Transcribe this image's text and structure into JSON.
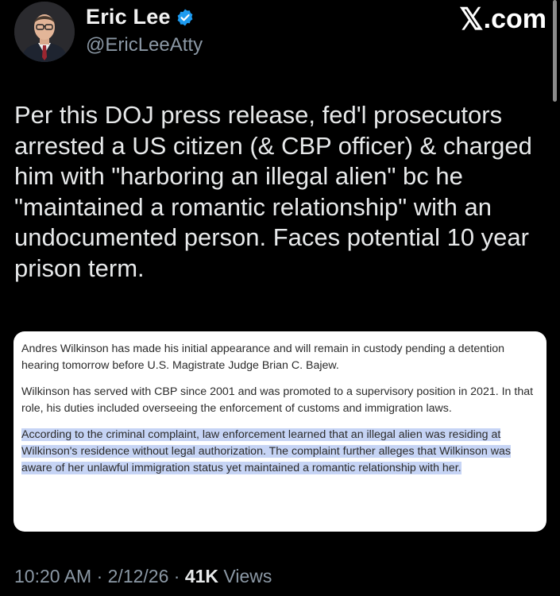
{
  "author": {
    "name": "Eric Lee",
    "handle": "@EricLeeAtty"
  },
  "brand": {
    "x_mark": "𝕏",
    "suffix": ".com"
  },
  "tweet": {
    "text": "Per this DOJ press release, fed'l prosecutors\narrested a US citizen (& CBP officer) & charged\nhim with \"harboring an illegal alien\" bc he\n\"maintained a romantic relationship\" with an\nundocumented person. Faces potential 10 year\nprison term."
  },
  "press_release": {
    "para1": "Andres Wilkinson has made his initial appearance and will remain in custody pending a detention hearing tomorrow before U.S. Magistrate Judge Brian C. Bajew.",
    "para2": "Wilkinson has served with CBP since 2001 and was promoted to a supervisory position in 2021. In that role, his duties included overseeing the enforcement of customs and immigration laws.",
    "para3": "According to the criminal complaint, law enforcement learned that an illegal alien was residing at Wilkinson's residence without legal authorization. The complaint further alleges that Wilkinson was aware of her unlawful immigration status yet maintained a romantic relationship with her."
  },
  "meta": {
    "time": "10:20 AM",
    "sep1": " · ",
    "date": "2/12/26",
    "sep2": " · ",
    "views_count": "41K",
    "views_label": " Views"
  },
  "colors": {
    "background": "#000000",
    "verified_badge": "#1d9bf0",
    "highlight": "#c6d4f5",
    "muted_text": "#8b98a5"
  }
}
